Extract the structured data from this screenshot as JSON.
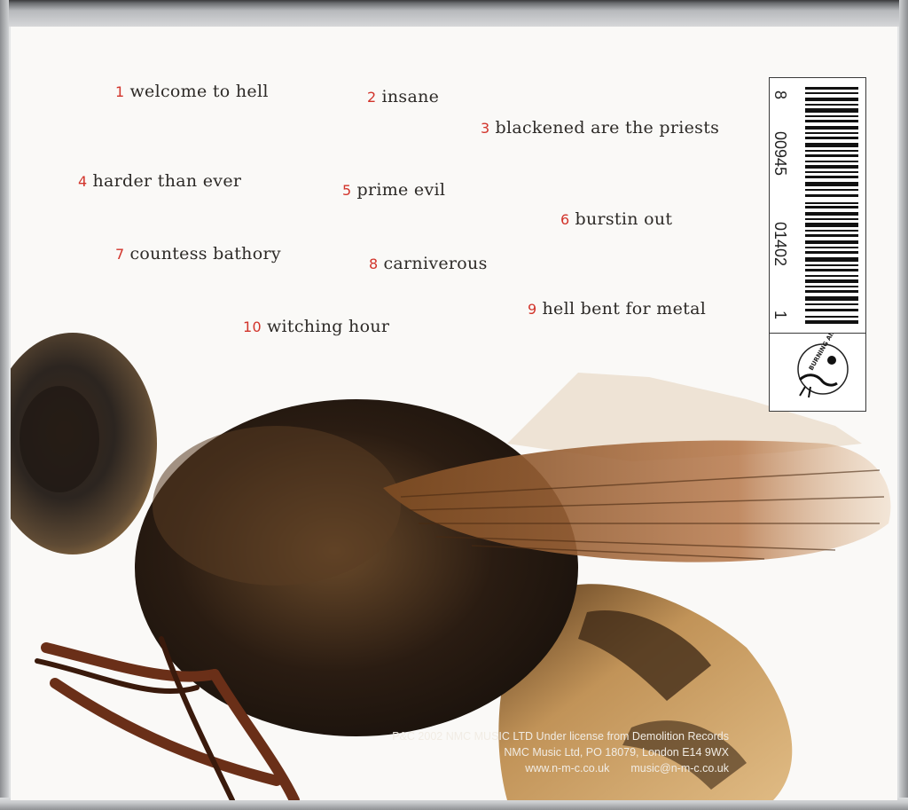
{
  "tracks": [
    {
      "number": "1",
      "title": "welcome to hell"
    },
    {
      "number": "2",
      "title": "insane"
    },
    {
      "number": "3",
      "title": "blackened are the priests"
    },
    {
      "number": "4",
      "title": "harder than ever"
    },
    {
      "number": "5",
      "title": "prime evil"
    },
    {
      "number": "6",
      "title": "burstin out"
    },
    {
      "number": "7",
      "title": "countess bathory"
    },
    {
      "number": "8",
      "title": "carniverous"
    },
    {
      "number": "9",
      "title": "hell bent for metal"
    },
    {
      "number": "10",
      "title": "witching hour"
    }
  ],
  "barcode": {
    "prefix": "8",
    "group1": "00945",
    "group2": "01402",
    "check": "1"
  },
  "logo": {
    "text": "BURNING AIRLINES",
    "icon": "pinup-logo-icon"
  },
  "credits": {
    "line1": "P&C 2002 NMC MUSIC LTD Under license from Demolition Records",
    "line2": "NMC Music Ltd, PO 18079, London E14 9WX",
    "website": "www.n-m-c.co.uk",
    "email": "music@n-m-c.co.uk"
  },
  "colors": {
    "track_number": "#d2342b",
    "track_title": "#2d2a27",
    "background": "#faf9f7"
  }
}
